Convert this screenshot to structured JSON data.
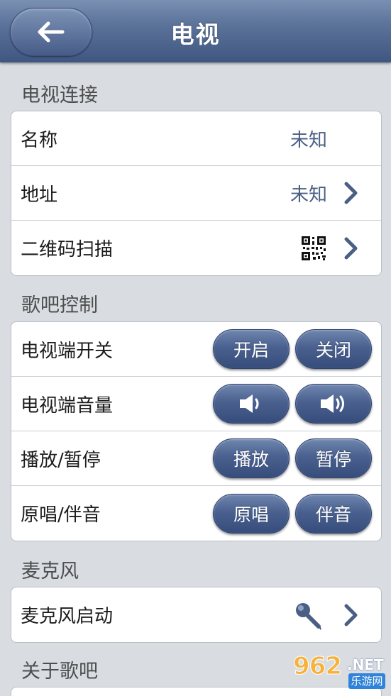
{
  "header": {
    "title": "电视"
  },
  "sections": [
    {
      "label": "电视连接",
      "rows": [
        {
          "label": "名称",
          "value": "未知"
        },
        {
          "label": "地址",
          "value": "未知"
        },
        {
          "label": "二维码扫描"
        }
      ]
    },
    {
      "label": "歌吧控制",
      "rows": [
        {
          "label": "电视端开关",
          "buttons": [
            "开启",
            "关闭"
          ]
        },
        {
          "label": "电视端音量",
          "buttons": [
            "volume-down-icon",
            "volume-up-icon"
          ]
        },
        {
          "label": "播放/暂停",
          "buttons": [
            "播放",
            "暂停"
          ]
        },
        {
          "label": "原唱/伴音",
          "buttons": [
            "原唱",
            "伴音"
          ]
        }
      ]
    },
    {
      "label": "麦克风",
      "rows": [
        {
          "label": "麦克风启动"
        }
      ]
    },
    {
      "label": "关于歌吧"
    }
  ],
  "watermark": {
    "brand": "962",
    "net": ".NET",
    "sub": "乐游网"
  },
  "colors": {
    "header": "#4f6690",
    "button": "#4a6190",
    "value_text": "#4a5f83",
    "background": "#d9dde2"
  }
}
